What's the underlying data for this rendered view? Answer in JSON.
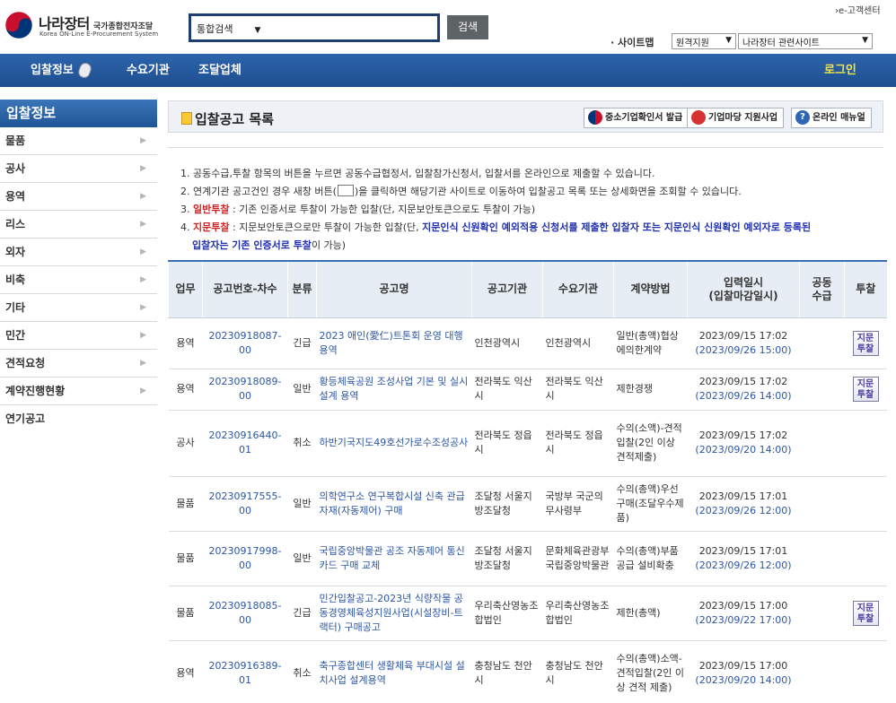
{
  "header": {
    "logo_title": "나라장터",
    "logo_subtitle": "국가종합전자조달",
    "logo_english": "Korea ON-Line E-Procurement System",
    "search_select_value": "통합검색",
    "search_button": "검색",
    "cs_link": "›e-고객센터",
    "sitemap": "· 사이트맵",
    "select1_value": "원격지원",
    "select2_value": "나라장터 관련사이트"
  },
  "nav": {
    "items": [
      "입찰정보",
      "수요기관",
      "조달업체"
    ],
    "login": "로그인"
  },
  "sidebar": {
    "title": "입찰정보",
    "items": [
      {
        "label": "물품",
        "arrow": true
      },
      {
        "label": "공사",
        "arrow": true
      },
      {
        "label": "용역",
        "arrow": true
      },
      {
        "label": "리스",
        "arrow": true
      },
      {
        "label": "외자",
        "arrow": true
      },
      {
        "label": "비축",
        "arrow": true
      },
      {
        "label": "기타",
        "arrow": true
      },
      {
        "label": "민간",
        "arrow": true
      },
      {
        "label": "견적요청",
        "arrow": true
      },
      {
        "label": "계약진행현황",
        "arrow": true
      },
      {
        "label": "연기공고",
        "arrow": false
      }
    ]
  },
  "main": {
    "title": "입찰공고 목록",
    "btn_cert": "중소기업확인서 발급",
    "btn_support": "기업마당 지원사업",
    "btn_manual": "온라인 매뉴얼",
    "btn_manual_icon": "?"
  },
  "notice": {
    "line1": "1. 공동수급,투찰 항목의 버튼을 누르면 공동수급협정서, 입찰참가신청서, 입찰서를 온라인으로 제출할 수 있습니다.",
    "line2_a": "2. 연계기관 공고건인 경우 새창 버튼(",
    "line2_b": ")을 클릭하면 해당기관 사이트로 이동하여 입찰공고 목록 또는 상세화면을 조회할 수 있습니다.",
    "line3_num": "3. ",
    "line3_red": "일반투찰",
    "line3_rest": " : 기존 인증서로 투찰이 가능한 입찰(단, 지문보안토큰으로도 투찰이 가능)",
    "line4_num": "4. ",
    "line4_red": "지문투찰",
    "line4_rest": " : 지문보안토큰으로만 투찰이 가능한 입찰(단, ",
    "line4_blue1": "지문인식 신원확인 예외적용 신청서를 제출한 입찰자 또는 지문인식 신원확인 예외자로 등록된",
    "line4_blue2": "입찰자는 기존 인증서로 투찰",
    "line4_end": "이 가능)"
  },
  "table": {
    "headers": [
      "업무",
      "공고번호-차수",
      "분류",
      "공고명",
      "공고기관",
      "수요기관",
      "계약방법",
      "입력일시\n(입찰마감일시)",
      "공동\n수급",
      "투찰"
    ],
    "bid_button": "지문\n투찰",
    "rows": [
      {
        "biz": "용역",
        "no": "20230918087-00",
        "cls": "긴급",
        "name": "2023 애인(愛仁)트톤회 운영 대행용역",
        "org": "인천광역시",
        "dem": "인천광역시",
        "method": "일반(총액)협상에의한계약",
        "d1": "2023/09/15 17:02",
        "d2": "(2023/09/26 15:00)",
        "bid": true
      },
      {
        "biz": "용역",
        "no": "20230918089-00",
        "cls": "일반",
        "name": "황등체육공원 조성사업 기본 및 실시설계 용역",
        "org": "전라북도 익산시",
        "dem": "전라북도 익산시",
        "method": "제한경쟁",
        "d1": "2023/09/15 17:02",
        "d2": "(2023/09/26 14:00)",
        "bid": true
      },
      {
        "biz": "공사",
        "no": "20230916440-01",
        "cls": "취소",
        "name": "하반기국지도49호선가로수조성공사",
        "org": "전라북도 정읍시",
        "dem": "전라북도 정읍시",
        "method": "수의(소액)-견적입찰(2인 이상 견적제출)",
        "d1": "2023/09/15 17:02",
        "d2": "(2023/09/20 14:00)",
        "bid": false
      },
      {
        "biz": "물품",
        "no": "20230917555-00",
        "cls": "일반",
        "name": "의학연구소 연구복합시설 신축 관급자재(자동제어) 구매",
        "org": "조달청 서울지방조달청",
        "dem": "국방부 국군의무사령부",
        "method": "수의(총액)우선구매(조달우수제품)",
        "d1": "2023/09/15 17:01",
        "d2": "(2023/09/26 12:00)",
        "bid": false
      },
      {
        "biz": "물품",
        "no": "20230917998-00",
        "cls": "일반",
        "name": "국립중앙박물관 공조 자동제어 통신카드 구매 교체",
        "org": "조달청 서울지방조달청",
        "dem": "문화체육관광부 국립중앙박물관",
        "method": "수의(총액)부품공급 설비확충",
        "d1": "2023/09/15 17:01",
        "d2": "(2023/09/26 12:00)",
        "bid": false
      },
      {
        "biz": "물품",
        "no": "20230918085-00",
        "cls": "긴급",
        "name": "민간입찰공고-2023년 식량작물 공동경영체육성지원사업(시설장비-트랙터) 구매공고",
        "org": "우리축산영농조합법인",
        "dem": "우리축산영농조합법인",
        "method": "제한(총액)",
        "d1": "2023/09/15 17:00",
        "d2": "(2023/09/22 17:00)",
        "bid": true
      },
      {
        "biz": "용역",
        "no": "20230916389-01",
        "cls": "취소",
        "name": "축구종합센터 생활체육 부대시설 설치사업 설계용역",
        "org": "충청남도 천안시",
        "dem": "충청남도 천안시",
        "method": "수의(총액)소액-견적입찰(2인 이상 견적 제출)",
        "d1": "2023/09/15 17:00",
        "d2": "(2023/09/20 14:00)",
        "bid": false
      }
    ]
  }
}
